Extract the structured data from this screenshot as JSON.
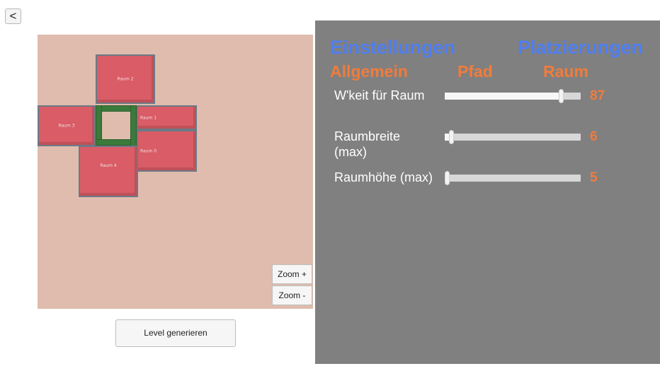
{
  "back_button": {
    "label": "<"
  },
  "map": {
    "rooms": [
      {
        "id": "raum-2",
        "label": "Raum 2"
      },
      {
        "id": "raum-3",
        "label": "Raum 3"
      },
      {
        "id": "raum-1",
        "label": "Raum 1"
      },
      {
        "id": "raum-0",
        "label": "Raum 0"
      },
      {
        "id": "raum-4",
        "label": "Raum 4"
      }
    ],
    "zoom_in_label": "Zoom +",
    "zoom_out_label": "Zoom -"
  },
  "generate_button": {
    "label": "Level generieren"
  },
  "panel": {
    "top_tabs": [
      "Einstellungen",
      "Platzierungen"
    ],
    "sub_tabs": [
      "Allgemein",
      "Pfad",
      "Raum"
    ],
    "settings": [
      {
        "label": "W'keit für Raum",
        "value": "87",
        "fraction": 0.87
      },
      {
        "label": "Raumbreite (max)",
        "value": "6",
        "fraction": 0.03
      },
      {
        "label": "Raumhöhe (max)",
        "value": "5",
        "fraction": 0.0
      }
    ]
  },
  "colors": {
    "tab_blue": "#4f7ef0",
    "tab_orange": "#f07c3c",
    "panel_bg": "#808080",
    "map_bg": "#dfbcad",
    "room_fill": "#d95c66",
    "path_green": "#3a7a3a"
  }
}
